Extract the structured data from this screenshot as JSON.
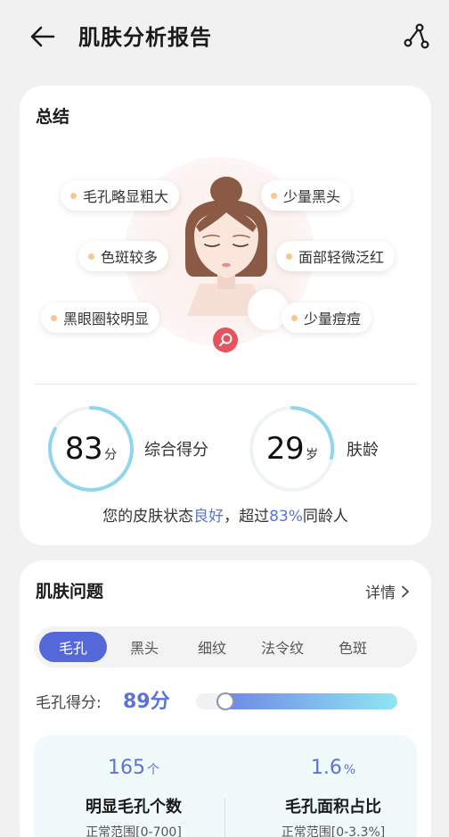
{
  "header": {
    "title": "肌肤分析报告",
    "back_icon": "arrow-left-icon",
    "share_icon": "share-icon"
  },
  "summary": {
    "title": "总结",
    "tags": [
      "毛孔略显粗大",
      "少量黑头",
      "色斑较多",
      "面部轻微泛红",
      "黑眼圈较明显",
      "少量痘痘"
    ],
    "tag_dot_color": "#f7c88e",
    "score": {
      "value": "83",
      "unit": "分",
      "label": "综合得分",
      "level": 0.83
    },
    "age": {
      "value": "29",
      "unit": "岁",
      "label": "肤龄"
    },
    "status": {
      "prefix": "您的皮肤状态",
      "level": "良好",
      "middle": "，超过",
      "percent": "83%",
      "suffix": "同龄人"
    },
    "accent_color": "#5b73d7"
  },
  "issues": {
    "title": "肌肤问题",
    "detail_label": "详情",
    "tabs": [
      "毛孔",
      "黑头",
      "细纹",
      "法令纹",
      "色斑"
    ],
    "active_tab": "毛孔",
    "score_label": "毛孔得分:",
    "score_value": "89分",
    "score_level": 0.89,
    "stats": [
      {
        "value": "165",
        "unit": "个",
        "name": "明显毛孔个数",
        "range": "正常范围[0-700]"
      },
      {
        "value": "1.6",
        "unit": "%",
        "name": "毛孔面积占比",
        "range": "正常范围[0-3.3%]"
      }
    ]
  }
}
